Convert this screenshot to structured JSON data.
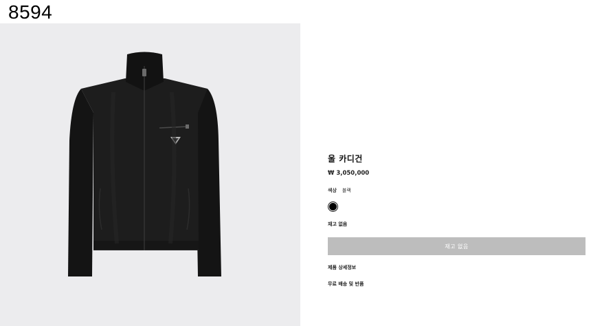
{
  "page_id": "8594",
  "product": {
    "title": "울 카디건",
    "price": "₩ 3,050,000",
    "color_label": "색상",
    "color_value": "블랙",
    "swatch_color": "#000000",
    "stock_status": "재고 없음",
    "soldout_button_label": "재고 없음",
    "details_link": "제품 상세정보",
    "shipping_link": "무료 배송 및 반품"
  },
  "colors": {
    "image_background": "#ececee",
    "button_background": "#bdbdbd",
    "garment": "#1b1b1b"
  }
}
